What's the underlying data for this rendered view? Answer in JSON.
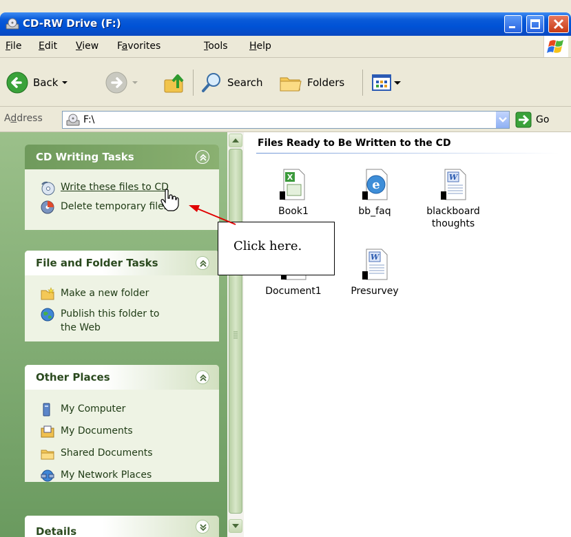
{
  "window": {
    "title": "CD-RW Drive (F:)"
  },
  "menu": {
    "file": {
      "hotkey": "F",
      "rest": "ile"
    },
    "edit": {
      "hotkey": "E",
      "rest": "dit"
    },
    "view": {
      "hotkey": "V",
      "rest": "iew"
    },
    "favorites": {
      "pre": "F",
      "hotkey": "a",
      "rest": "vorites"
    },
    "tools": {
      "hotkey": "T",
      "rest": "ools"
    },
    "help": {
      "hotkey": "H",
      "rest": "elp"
    }
  },
  "toolbar": {
    "back": "Back",
    "search": "Search",
    "folders": "Folders"
  },
  "address": {
    "label_pre": "A",
    "label_hotkey": "d",
    "label_rest": "dress",
    "value": "F:\\",
    "go": "Go"
  },
  "taskpane": {
    "cd_tasks": {
      "title": "CD Writing Tasks",
      "items": [
        {
          "label": "Write these files to CD",
          "icon": "cd-burn-icon"
        },
        {
          "label": "Delete temporary files",
          "icon": "delete-temp-icon"
        }
      ]
    },
    "file_tasks": {
      "title": "File and Folder Tasks",
      "items": [
        {
          "label": "Make a new folder",
          "icon": "new-folder-icon"
        },
        {
          "label": "Publish this folder to the Web",
          "icon": "publish-web-icon"
        }
      ]
    },
    "other_places": {
      "title": "Other Places",
      "items": [
        {
          "label": "My Computer",
          "icon": "my-computer-icon"
        },
        {
          "label": "My Documents",
          "icon": "my-documents-icon"
        },
        {
          "label": "Shared Documents",
          "icon": "shared-documents-icon"
        },
        {
          "label": "My Network Places",
          "icon": "network-places-icon"
        }
      ]
    },
    "details": {
      "title": "Details"
    }
  },
  "content": {
    "group_title": "Files Ready to Be Written to the CD",
    "files": [
      {
        "name": "Book1",
        "type": "excel"
      },
      {
        "name": "bb_faq",
        "type": "html"
      },
      {
        "name": "blackboard thoughts",
        "type": "word"
      },
      {
        "name": "Document1",
        "type": "word"
      },
      {
        "name": "Presurvey",
        "type": "word"
      }
    ]
  },
  "annotation": {
    "text": "Click here."
  },
  "colors": {
    "titlebar": "#0a5bd8",
    "taskpane": "#84ad74",
    "annotation_arrow": "#e00000"
  }
}
